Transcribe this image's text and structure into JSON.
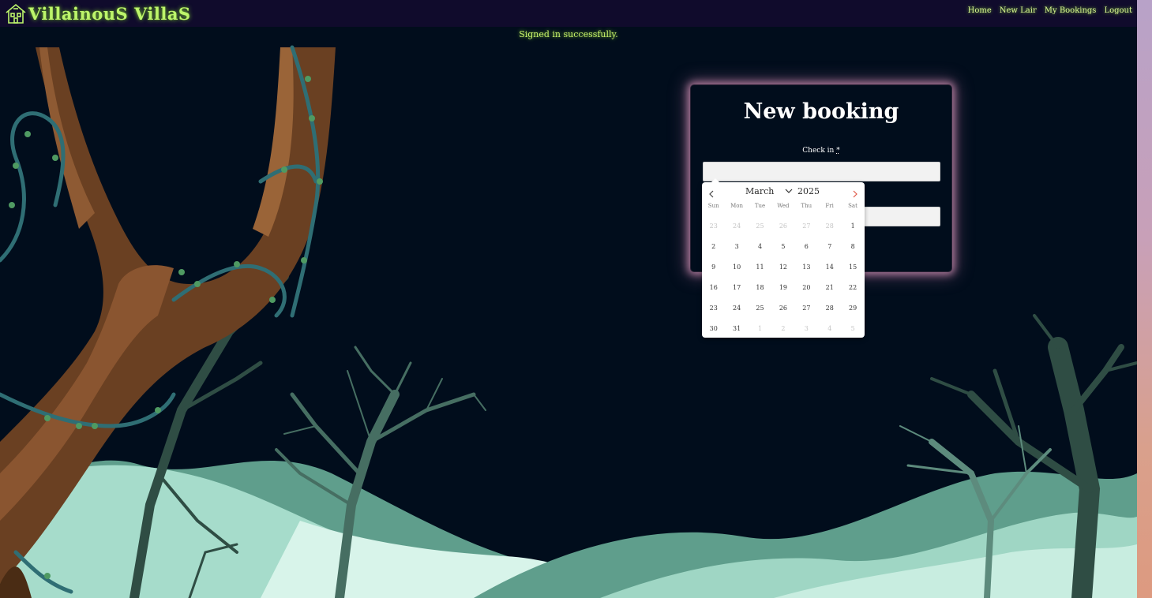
{
  "brand": {
    "name": "VillainouS VillaS"
  },
  "nav": {
    "items": [
      "Home",
      "New Lair",
      "My Bookings",
      "Logout"
    ]
  },
  "flash": {
    "message": "Signed in successfully."
  },
  "form": {
    "title": "New booking",
    "check_in_label": "Check in",
    "required_mark": "*",
    "check_in_value": "",
    "check_out_value": ""
  },
  "calendar": {
    "month": "March",
    "year": "2025",
    "weekdays": [
      "Sun",
      "Mon",
      "Tue",
      "Wed",
      "Thu",
      "Fri",
      "Sat"
    ],
    "days": [
      {
        "n": "23",
        "muted": true
      },
      {
        "n": "24",
        "muted": true
      },
      {
        "n": "25",
        "muted": true
      },
      {
        "n": "26",
        "muted": true
      },
      {
        "n": "27",
        "muted": true
      },
      {
        "n": "28",
        "muted": true
      },
      {
        "n": "1",
        "muted": false
      },
      {
        "n": "2",
        "muted": false
      },
      {
        "n": "3",
        "muted": false
      },
      {
        "n": "4",
        "muted": false
      },
      {
        "n": "5",
        "muted": false
      },
      {
        "n": "6",
        "muted": false
      },
      {
        "n": "7",
        "muted": false
      },
      {
        "n": "8",
        "muted": false
      },
      {
        "n": "9",
        "muted": false
      },
      {
        "n": "10",
        "muted": false
      },
      {
        "n": "11",
        "muted": false
      },
      {
        "n": "12",
        "muted": false
      },
      {
        "n": "13",
        "muted": false
      },
      {
        "n": "14",
        "muted": false
      },
      {
        "n": "15",
        "muted": false
      },
      {
        "n": "16",
        "muted": false
      },
      {
        "n": "17",
        "muted": false
      },
      {
        "n": "18",
        "muted": false
      },
      {
        "n": "19",
        "muted": false
      },
      {
        "n": "20",
        "muted": false
      },
      {
        "n": "21",
        "muted": false
      },
      {
        "n": "22",
        "muted": false
      },
      {
        "n": "23",
        "muted": false
      },
      {
        "n": "24",
        "muted": false
      },
      {
        "n": "25",
        "muted": false
      },
      {
        "n": "26",
        "muted": false
      },
      {
        "n": "27",
        "muted": false
      },
      {
        "n": "28",
        "muted": false
      },
      {
        "n": "29",
        "muted": false
      },
      {
        "n": "30",
        "muted": false
      },
      {
        "n": "31",
        "muted": false
      },
      {
        "n": "1",
        "muted": true
      },
      {
        "n": "2",
        "muted": true
      },
      {
        "n": "3",
        "muted": true
      },
      {
        "n": "4",
        "muted": true
      },
      {
        "n": "5",
        "muted": true
      }
    ]
  },
  "colors": {
    "background": "#010d1c",
    "nav_bg": "#100b2c",
    "brand_green": "#bdf56b",
    "card_glow": "#d796b9",
    "next_arrow": "#e05a4a"
  }
}
